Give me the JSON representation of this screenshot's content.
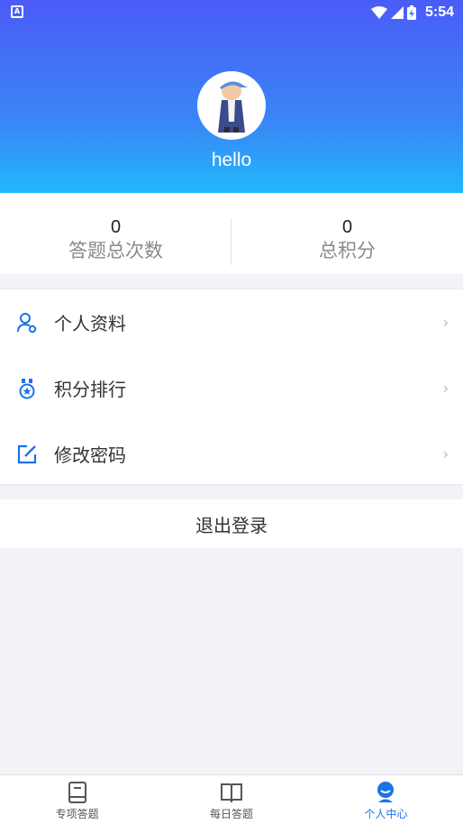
{
  "status_bar": {
    "time": "5:54"
  },
  "profile": {
    "username": "hello"
  },
  "stats": [
    {
      "value": "0",
      "label": "答题总次数"
    },
    {
      "value": "0",
      "label": "总积分"
    }
  ],
  "menu": [
    {
      "label": "个人资料",
      "icon": "user-settings-icon"
    },
    {
      "label": "积分排行",
      "icon": "medal-icon"
    },
    {
      "label": "修改密码",
      "icon": "edit-icon"
    }
  ],
  "logout": {
    "label": "退出登录"
  },
  "tabs": [
    {
      "label": "专项答题",
      "icon": "book-icon",
      "active": false
    },
    {
      "label": "每日答题",
      "icon": "open-book-icon",
      "active": false
    },
    {
      "label": "个人中心",
      "icon": "person-icon",
      "active": true
    }
  ],
  "colors": {
    "accent": "#1a73e8",
    "header_top": "#4a5cf7",
    "header_bottom": "#19c8fb"
  }
}
